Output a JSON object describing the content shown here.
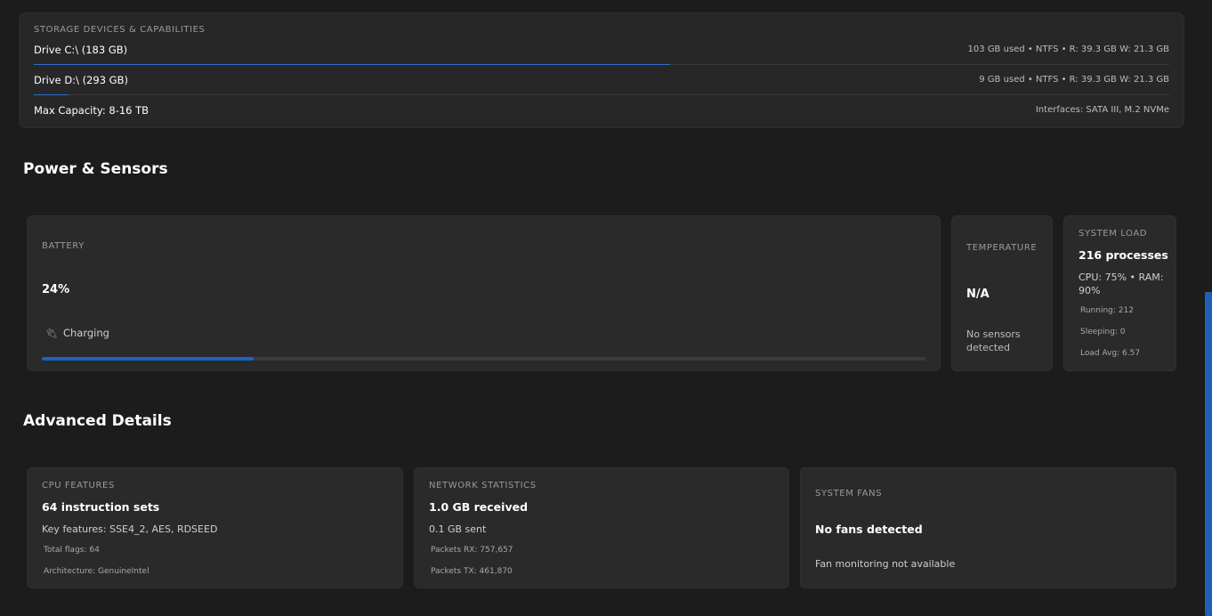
{
  "storage": {
    "title": "STORAGE DEVICES & CAPABILITIES",
    "drives": [
      {
        "name": "Drive C:\\ (183 GB)",
        "meta": "103 GB used • NTFS • R: 39.3 GB W: 21.3 GB",
        "used_fraction": 0.56
      },
      {
        "name": "Drive D:\\ (293 GB)",
        "meta": "9 GB used • NTFS • R: 39.3 GB W: 21.3 GB",
        "used_fraction": 0.03
      }
    ],
    "max_capacity": "Max Capacity: 8-16 TB",
    "interfaces": "Interfaces: SATA III, M.2 NVMe"
  },
  "power": {
    "section_title": "Power & Sensors",
    "battery": {
      "label": "BATTERY",
      "percent": "24%",
      "status": "Charging",
      "level": 0.24
    },
    "temperature": {
      "label": "TEMPERATURE",
      "value": "N/A",
      "note": "No sensors detected"
    },
    "load": {
      "label": "SYSTEM LOAD",
      "processes": "216 processes",
      "cpu_ram": "CPU: 75% • RAM: 90%",
      "running": "Running: 212",
      "sleeping": "Sleeping: 0",
      "load_avg": "Load Avg: 6.57"
    }
  },
  "advanced": {
    "section_title": "Advanced Details",
    "cpu": {
      "label": "CPU FEATURES",
      "headline": "64 instruction sets",
      "key_features": "Key features: SSE4_2, AES, RDSEED",
      "total_flags": "Total flags: 64",
      "architecture": "Architecture: GenuineIntel"
    },
    "network": {
      "label": "NETWORK STATISTICS",
      "received": "1.0 GB received",
      "sent": "0.1 GB sent",
      "packets_rx": "Packets RX: 757,657",
      "packets_tx": "Packets TX: 461,870"
    },
    "fans": {
      "label": "SYSTEM FANS",
      "headline": "No fans detected",
      "note": "Fan monitoring not available"
    }
  },
  "colors": {
    "background": "#1c1c1c",
    "card": "#2a2a2a",
    "accent": "#1b63c7"
  },
  "icons": {
    "charging": "plug-icon"
  }
}
